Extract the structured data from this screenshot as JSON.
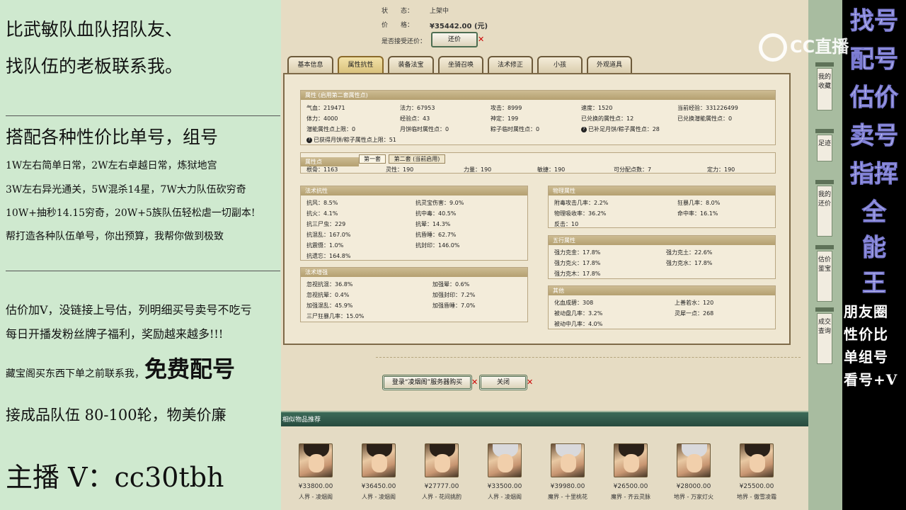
{
  "left_panel": {
    "line1": "比武敏队血队招队友、",
    "line2": "找队伍的老板联系我。",
    "line3": "搭配各种性价比单号，组号",
    "line4": "1W左右简单日常，2W左右卓越日常，炼狱地宫",
    "line5": "3W左右异光通关，5W混杀14星，7W大力队伍砍穷奇",
    "line6": "10W+抽秒14.15穷奇，20W+5族队伍轻松虐一切副本!",
    "line7": "帮打造各种队伍单号，你出预算，我帮你做到极致",
    "line8": "估价加V，没链接上号估，列明细买号卖号不吃亏",
    "line9": "每日开播发粉丝牌子福利，奖励越来越多!!!",
    "line10a": "藏宝阁买东西下单之前联系我，",
    "line10b": "免费配号",
    "line11": "接成品队伍 80-100轮，物美价廉",
    "line12": "主播 V：cc30tbh"
  },
  "top_info": {
    "status_label": "状　　态：",
    "status_value": "上架中",
    "price_label": "价　　格：",
    "price_value": "¥35442.00 (元)",
    "bargain_label": "是否接受还价：",
    "bargain_button": "还价"
  },
  "tabs": [
    "基本信息",
    "属性抗性",
    "装备法宝",
    "坐骑召唤",
    "法术修正",
    "小孩",
    "外观道具"
  ],
  "attr": {
    "title": "属性 (启用第二套属性点)",
    "rows": [
      [
        "气血：219471",
        "法力：67953",
        "攻击：8999",
        "速度：1520",
        "当前经验：331226499"
      ],
      [
        "体力：4000",
        "经验点：43",
        "神定：199",
        "已兑换的属性点：12",
        "已兑换潜能属性点：0"
      ],
      [
        "潜能属性点上限：0",
        "月饼临时属性点：0",
        "粽子临时属性点：0",
        "已补足月饼/粽子属性点：28",
        ""
      ]
    ],
    "footer": "已获得月饼/粽子属性点上限：51"
  },
  "points": {
    "title": "属性点",
    "subtab1": "第一套",
    "subtab2": "第二套 (当前启用)",
    "values": [
      "根骨：1163",
      "灵性：190",
      "力量：190",
      "敏捷：190",
      "可分配点数：7",
      "定力：190"
    ]
  },
  "spell_resist": {
    "title": "法术抗性",
    "rows": [
      [
        "抗风：8.5%",
        "抗灵宝伤害：9.0%"
      ],
      [
        "抗火：4.1%",
        "抗中毒：40.5%"
      ],
      [
        "抗三尸虫：229",
        "抗晕：14.3%"
      ],
      [
        "抗混乱：167.0%",
        "抗昏睡：62.7%"
      ],
      [
        "抗震慑：1.0%",
        "抗封印：146.0%"
      ],
      [
        "抗遗忘：164.8%",
        ""
      ]
    ]
  },
  "physical": {
    "title": "物理属性",
    "rows": [
      [
        "附毒攻击几率：2.2%",
        "狂暴几率：8.0%"
      ],
      [
        "物理吸收率：36.2%",
        "命中率：16.1%"
      ],
      [
        "反击：10",
        ""
      ]
    ]
  },
  "five_elements": {
    "title": "五行属性",
    "rows": [
      [
        "强力克金：17.8%",
        "强力克土：22.6%"
      ],
      [
        "强力克火：17.8%",
        "强力克水：17.8%"
      ],
      [
        "强力克木：17.8%",
        ""
      ]
    ]
  },
  "spell_strength": {
    "title": "法术增强",
    "rows": [
      [
        "忽视抗混：36.8%",
        "加强晕：0.6%"
      ],
      [
        "忽视抗晕：0.4%",
        "加强封印：7.2%"
      ],
      [
        "加强混乱：45.9%",
        "加强昏睡：7.0%"
      ],
      [
        "三尸狂暴几率：15.0%",
        ""
      ]
    ]
  },
  "other": {
    "title": "其他",
    "rows": [
      [
        "化血成碧：308",
        "上善若水：120"
      ],
      [
        "被动盘几率：3.2%",
        "灵犀一点：268"
      ],
      [
        "被动中几率：4.0%",
        ""
      ]
    ]
  },
  "buttons": {
    "login_buy": "登录“凌烟阁”服务器购买",
    "close": "关闭"
  },
  "recommend": {
    "title": "相似物品推荐",
    "items": [
      {
        "price": "¥33800.00",
        "name": "人界 - 凌烟阁"
      },
      {
        "price": "¥36450.00",
        "name": "人界 - 凌烟阁"
      },
      {
        "price": "¥27777.00",
        "name": "人界 - 花间挑酌"
      },
      {
        "price": "¥33500.00",
        "name": "人界 - 凌烟阁"
      },
      {
        "price": "¥39980.00",
        "name": "魔界 - 十里桃花"
      },
      {
        "price": "¥26500.00",
        "name": "魔界 - 齐云灵脉"
      },
      {
        "price": "¥28000.00",
        "name": "地界 - 万家灯火"
      },
      {
        "price": "¥25500.00",
        "name": "地界 - 傲雪凌霜"
      }
    ]
  },
  "side_tabs": [
    "我的收藏",
    "足迹",
    "我的还价",
    "估价鉴宝",
    "成交查询"
  ],
  "right_panel": {
    "big_chars": [
      "找号",
      "配号",
      "估价",
      "卖号",
      "指挥",
      "全",
      "能",
      "王"
    ],
    "small_lines": [
      "朋友圈",
      "性价比",
      "单组号",
      "看号+V"
    ]
  },
  "watermark": "CC直播",
  "colors": {
    "left_bg": "#cfe9cf",
    "accent_green": "#274b3e",
    "price_red": "#c0141a"
  }
}
